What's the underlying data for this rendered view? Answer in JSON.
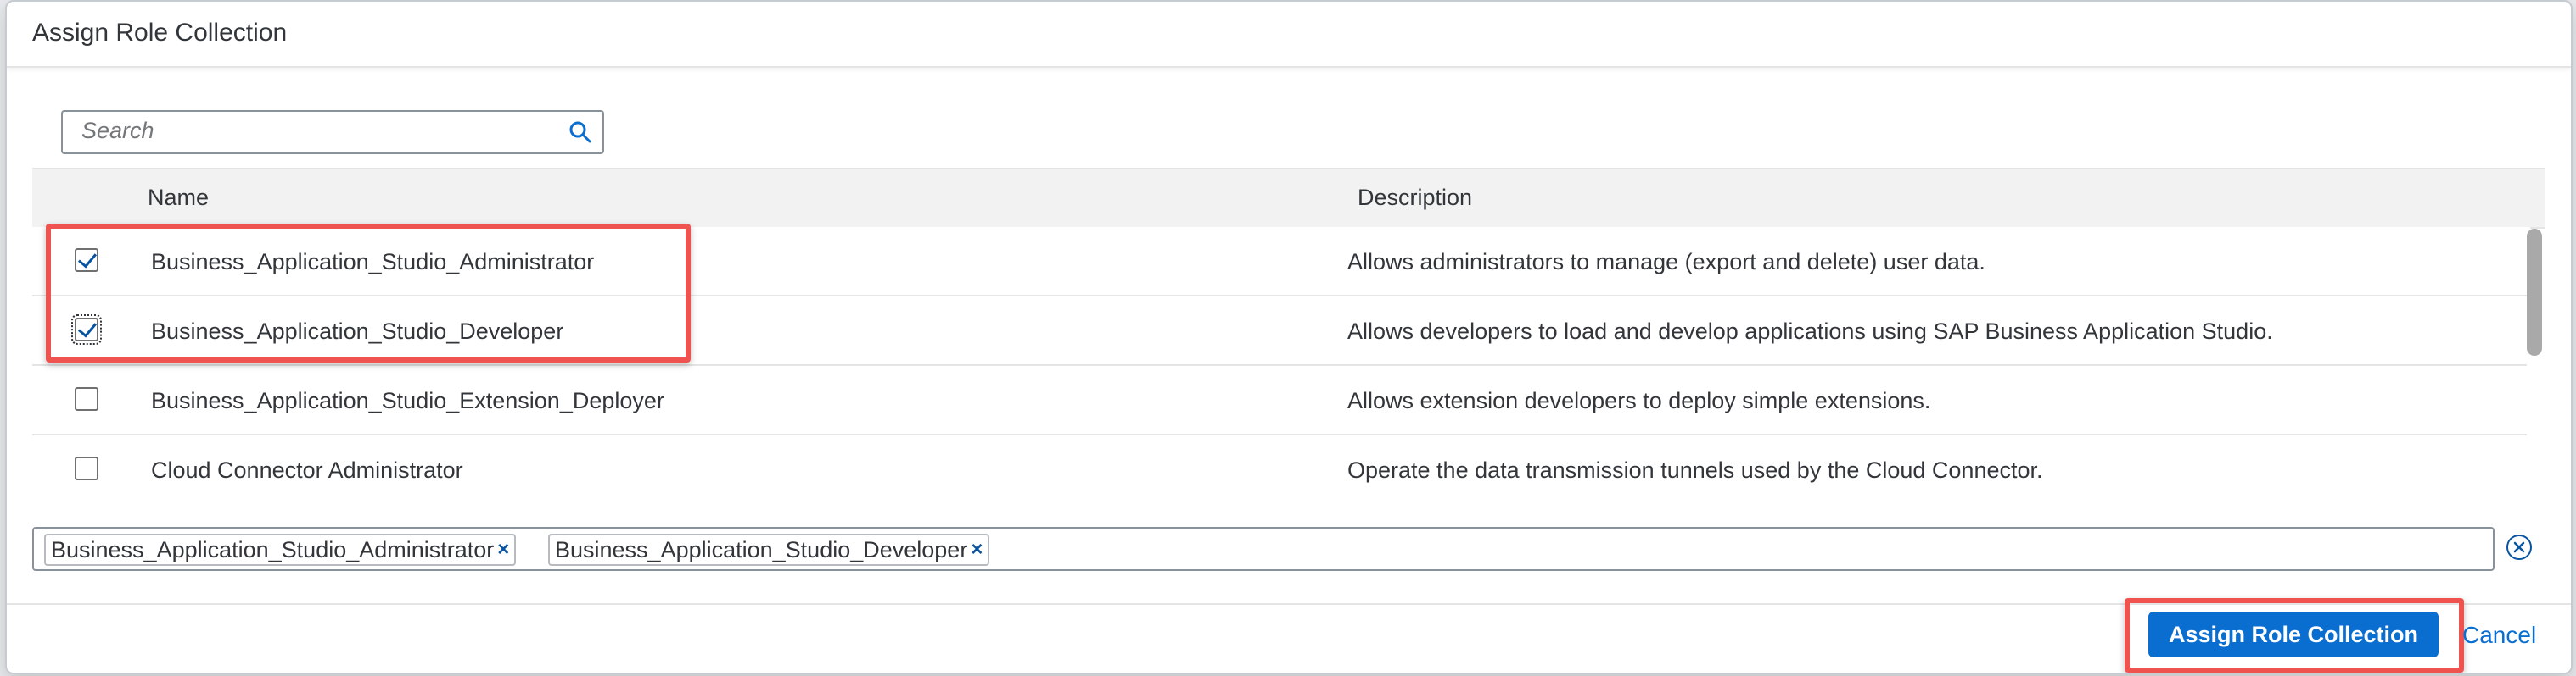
{
  "dialog": {
    "title": "Assign Role Collection"
  },
  "search": {
    "placeholder": "Search",
    "value": ""
  },
  "table": {
    "columns": {
      "name": "Name",
      "description": "Description"
    },
    "rows": [
      {
        "name": "Business_Application_Studio_Administrator",
        "description": "Allows administrators to manage (export and delete) user data.",
        "checked": true
      },
      {
        "name": "Business_Application_Studio_Developer",
        "description": "Allows developers to load and develop applications using SAP Business Application Studio.",
        "checked": true
      },
      {
        "name": "Business_Application_Studio_Extension_Deployer",
        "description": "Allows extension developers to deploy simple extensions.",
        "checked": false
      },
      {
        "name": "Cloud Connector Administrator",
        "description": "Operate the data transmission tunnels used by the Cloud Connector.",
        "checked": false
      }
    ]
  },
  "tokens": [
    {
      "label": "Business_Application_Studio_Administrator",
      "remove_symbol": "×"
    },
    {
      "label": "Business_Application_Studio_Developer",
      "remove_symbol": "×"
    }
  ],
  "footer": {
    "primary_button": "Assign Role Collection",
    "cancel_link": "Cancel"
  },
  "colors": {
    "accent": "#0a6ed1",
    "highlight": "#ef5350",
    "text": "#32363a"
  },
  "icons": {
    "search": "search-icon",
    "clear": "clear-all-icon",
    "token_remove": "close-icon"
  }
}
